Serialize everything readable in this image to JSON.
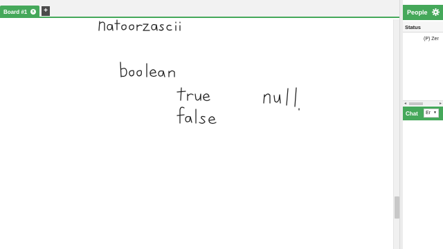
{
  "tabs": {
    "board_label": "Board #1",
    "close_glyph": "x",
    "add_glyph": "+"
  },
  "people": {
    "title": "People",
    "settings_icon": "gear-icon",
    "status_header": "Status",
    "rows": [
      {
        "label": "(P) Zer"
      }
    ]
  },
  "chat": {
    "title": "Chat",
    "language_value": "Er"
  },
  "scroll": {
    "left_glyph": "◂",
    "right_glyph": "▸"
  },
  "board": {
    "handwritten_words": [
      "natoorzascii",
      "boolean",
      "true",
      "false",
      "null"
    ]
  },
  "colors": {
    "accent": "#45a85a",
    "ink": "#222222"
  }
}
